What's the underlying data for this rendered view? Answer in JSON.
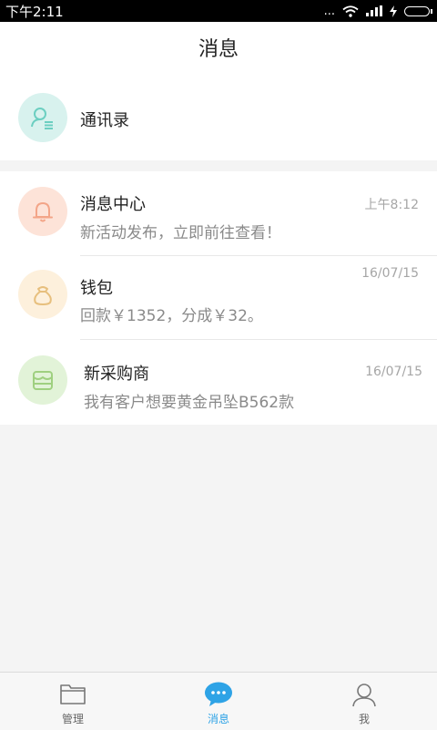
{
  "status_bar": {
    "time": "下午2:11",
    "signal_dots": "...",
    "icons": [
      "wifi-icon",
      "signal-icon",
      "charging-icon",
      "battery-icon"
    ]
  },
  "header": {
    "title": "消息"
  },
  "contacts": {
    "label": "通讯录",
    "icon": "contacts-icon",
    "icon_bg": "#d8f2ee",
    "icon_color": "#6ccfc1"
  },
  "messages": [
    {
      "title": "消息中心",
      "subtitle": "新活动发布，立即前往查看！",
      "time": "上午8:12",
      "icon": "bell-icon",
      "icon_bg": "#fde3d8",
      "icon_color": "#f3a588"
    },
    {
      "title": "钱包",
      "subtitle": "回款￥1352，分成￥32。",
      "time": "16/07/15",
      "icon": "money-bag-icon",
      "icon_bg": "#fdf0dc",
      "icon_color": "#e7bf7d"
    },
    {
      "title": "新采购商",
      "subtitle": "我有客户想要黄金吊坠B562款",
      "time": "16/07/15",
      "icon": "store-icon",
      "icon_bg": "#e2f3d8",
      "icon_color": "#9fd080"
    }
  ],
  "bottom_nav": {
    "tabs": [
      {
        "label": "管理",
        "icon": "folder-icon",
        "active": false
      },
      {
        "label": "消息",
        "icon": "chat-bubble-icon",
        "active": true
      },
      {
        "label": "我",
        "icon": "person-icon",
        "active": false
      }
    ],
    "active_color": "#2ea3e6"
  }
}
